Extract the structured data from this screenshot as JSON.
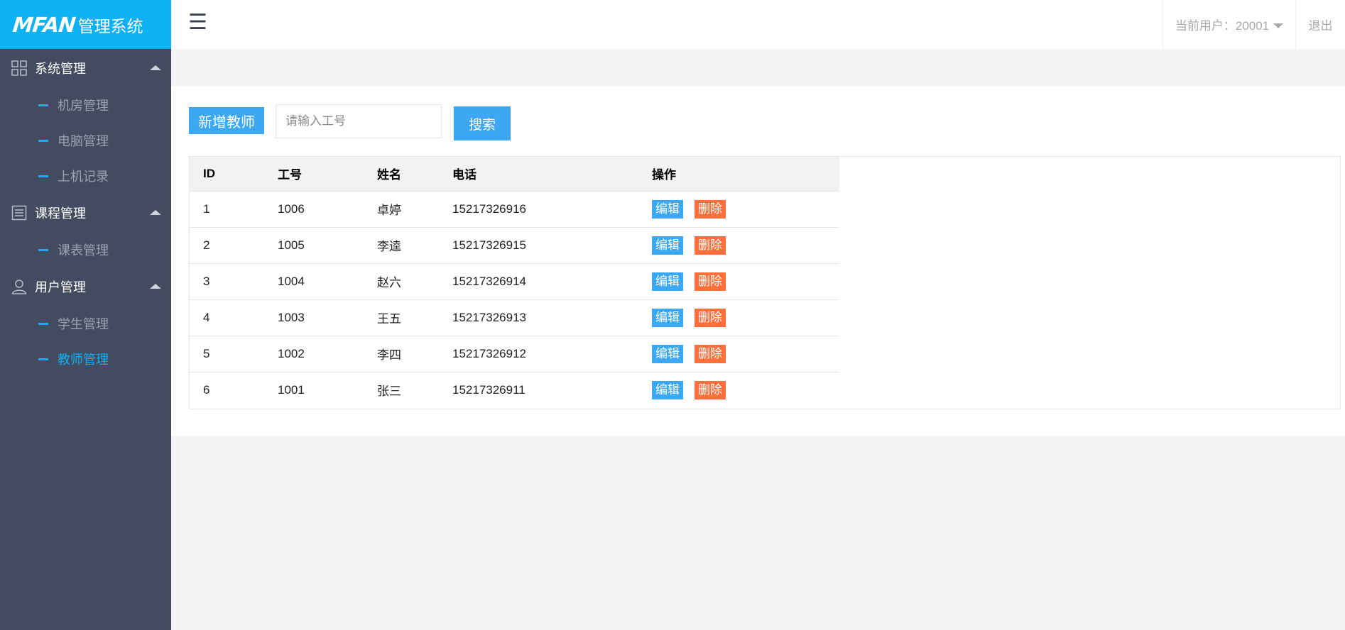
{
  "brand": {
    "logo": "MFAN",
    "title": "管理系统"
  },
  "topbar": {
    "menu_icon": "hamburger-icon",
    "current_user": "当前用户：20001",
    "logout": "退出"
  },
  "sidebar": {
    "groups": [
      {
        "label": "系统管理",
        "icon": "grid-icon",
        "items": [
          {
            "label": "机房管理"
          },
          {
            "label": "电脑管理"
          },
          {
            "label": "上机记录"
          }
        ]
      },
      {
        "label": "课程管理",
        "icon": "list-icon",
        "items": [
          {
            "label": "课表管理"
          }
        ]
      },
      {
        "label": "用户管理",
        "icon": "user-icon",
        "items": [
          {
            "label": "学生管理"
          },
          {
            "label": "教师管理"
          }
        ]
      }
    ],
    "active_item": "教师管理"
  },
  "toolbar": {
    "add_label": "新增教师",
    "search_placeholder": "请输入工号",
    "search_label": "搜索"
  },
  "table": {
    "headers": [
      "ID",
      "工号",
      "姓名",
      "电话",
      "操作"
    ],
    "rows": [
      {
        "id": "1",
        "no": "1006",
        "name": "卓婷",
        "phone": "15217326916"
      },
      {
        "id": "2",
        "no": "1005",
        "name": "李逵",
        "phone": "15217326915"
      },
      {
        "id": "3",
        "no": "1004",
        "name": "赵六",
        "phone": "15217326914"
      },
      {
        "id": "4",
        "no": "1003",
        "name": "王五",
        "phone": "15217326913"
      },
      {
        "id": "5",
        "no": "1002",
        "name": "李四",
        "phone": "15217326912"
      },
      {
        "id": "6",
        "no": "1001",
        "name": "张三",
        "phone": "15217326911"
      }
    ],
    "edit_label": "编辑",
    "delete_label": "删除"
  },
  "colors": {
    "accent": "#0eb1f3",
    "sidebar": "#434b60",
    "button": "#3ca8f3",
    "danger": "#ff6f3c"
  }
}
